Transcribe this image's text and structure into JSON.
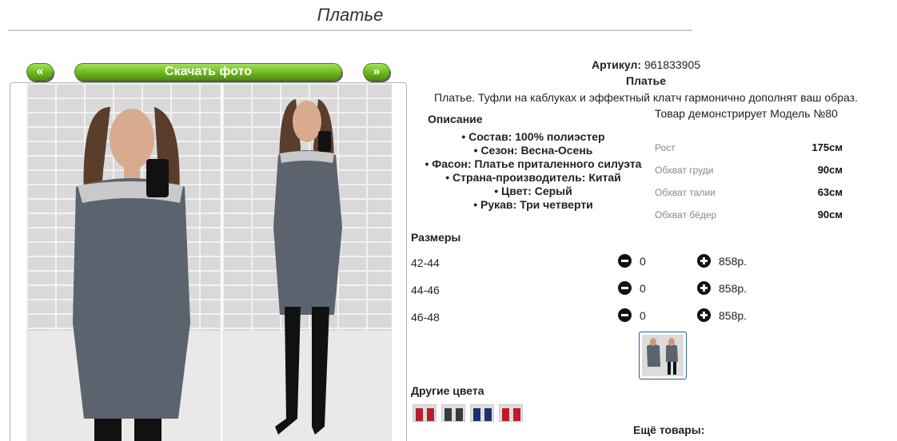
{
  "page": {
    "title": "Платье"
  },
  "gallery": {
    "prev_label": "«",
    "download_label": "Скачать фото",
    "next_label": "»"
  },
  "product": {
    "sku_label": "Артикул:",
    "sku_value": "961833905",
    "name": "Платье",
    "description": "Платье. Туфли на каблуках и эффектный клатч гармонично дополнят ваш образ."
  },
  "details": {
    "heading": "Описание",
    "items": [
      "• Состав: 100% полиэстер",
      "• Сезон: Весна-Осень",
      "• Фасон: Платье приталенного силуэта",
      "• Страна-производитель: Китай",
      "• Цвет: Серый",
      "• Рукав: Три четверти"
    ]
  },
  "model": {
    "caption": "Товар демонстрирует Модель №80",
    "measurements": [
      {
        "label": "Рост",
        "value": "175см"
      },
      {
        "label": "Обхват груди",
        "value": "90см"
      },
      {
        "label": "Обхват талии",
        "value": "63см"
      },
      {
        "label": "Обхват бёдер",
        "value": "90см"
      }
    ]
  },
  "sizes": {
    "heading": "Размеры",
    "rows": [
      {
        "size": "42-44",
        "qty": "0",
        "price": "858р."
      },
      {
        "size": "44-46",
        "qty": "0",
        "price": "858р."
      },
      {
        "size": "46-48",
        "qty": "0",
        "price": "858р."
      }
    ]
  },
  "other_colors": {
    "heading": "Другие цвета",
    "swatches": [
      {
        "color": "#b3202c"
      },
      {
        "color": "#3a3a3a"
      },
      {
        "color": "#1f2f6b"
      },
      {
        "color": "#c01a2a"
      }
    ]
  },
  "more": {
    "heading": "Ещё товары:"
  },
  "colors": {
    "dress": "#5b636e",
    "button_green": "#6cb81f"
  }
}
